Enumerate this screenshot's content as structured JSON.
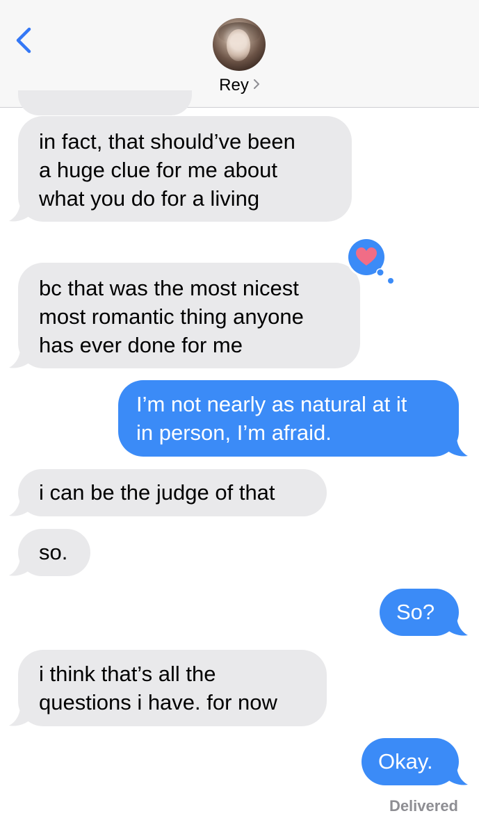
{
  "header": {
    "contact_name": "Rey",
    "chevron": "›",
    "back_icon": "chevron-left-icon",
    "accent_color": "#3478f6"
  },
  "messages": [
    {
      "from": "them",
      "lines": [
        "in fact, that should’ve been",
        "a huge clue for me about",
        "what you do for a living"
      ]
    },
    {
      "from": "them",
      "lines": [
        "bc that was the most nicest",
        "most romantic thing anyone",
        "has ever done for me"
      ],
      "reaction": "heart"
    },
    {
      "from": "me",
      "lines": [
        "I’m not nearly as natural at it",
        "in person, I’m afraid."
      ]
    },
    {
      "from": "them",
      "lines": [
        "i can be the judge of that"
      ]
    },
    {
      "from": "them",
      "lines": [
        "so."
      ]
    },
    {
      "from": "me",
      "lines": [
        "So?"
      ]
    },
    {
      "from": "them",
      "lines": [
        "i think that’s all the",
        "questions i have. for now"
      ]
    },
    {
      "from": "me",
      "lines": [
        "Okay."
      ]
    }
  ],
  "status": {
    "delivered": "Delivered"
  },
  "colors": {
    "incoming_bubble": "#e9e9eb",
    "outgoing_bubble": "#3b8bf7",
    "heart": "#f16d86",
    "tapback_bg": "#3b8bf7"
  }
}
